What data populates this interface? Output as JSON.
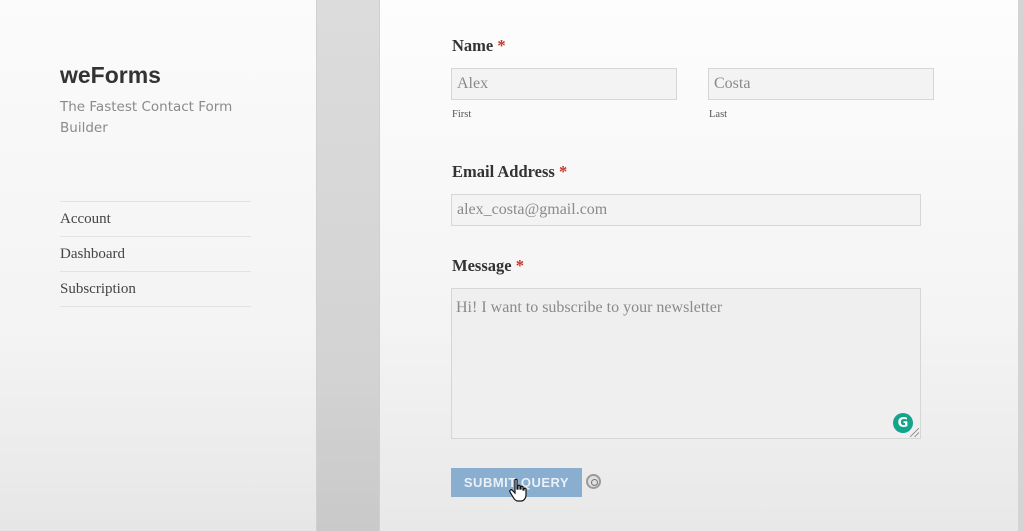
{
  "site": {
    "title": "weForms",
    "description": "The Fastest Contact Form Builder"
  },
  "menu": {
    "items": [
      {
        "label": "Account"
      },
      {
        "label": "Dashboard"
      },
      {
        "label": "Subscription"
      }
    ]
  },
  "form": {
    "name": {
      "label": "Name",
      "required_mark": "*",
      "first": {
        "value": "Alex",
        "sublabel": "First"
      },
      "last": {
        "value": "Costa",
        "sublabel": "Last"
      }
    },
    "email": {
      "label": "Email Address",
      "required_mark": "*",
      "value": "alex_costa@gmail.com"
    },
    "message": {
      "label": "Message",
      "required_mark": "*",
      "value": "Hi! I want to subscribe to your newsletter"
    },
    "submit_label": "SUBMIT QUERY"
  },
  "icons": {
    "grammarly": "grammarly-icon",
    "grammarly_glyph": "G",
    "spinner": "loading-spinner-icon",
    "cursor": "hand-cursor-icon"
  },
  "colors": {
    "required": "#c0392b",
    "submit_bg": "#8aaed0",
    "grammarly": "#15a38b"
  }
}
